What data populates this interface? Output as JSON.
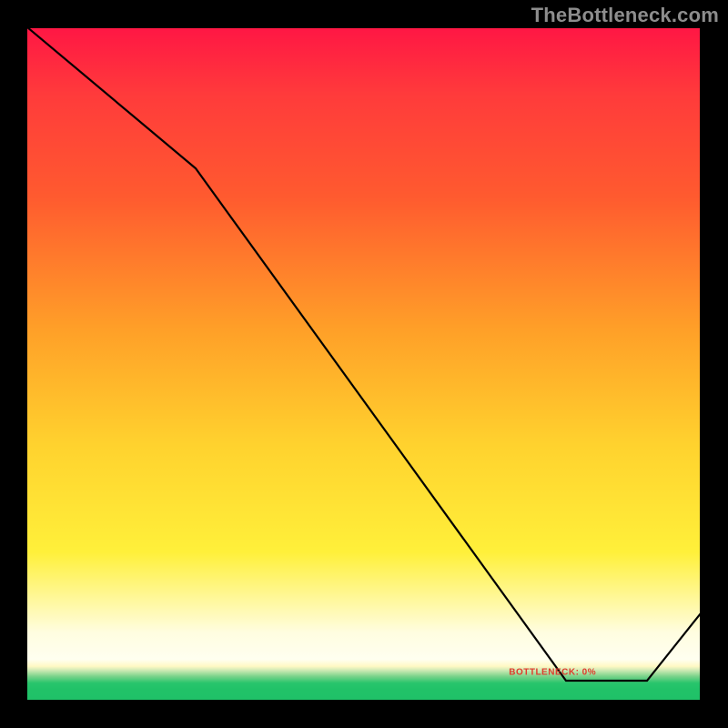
{
  "watermark": "TheBottleneck.com",
  "bottom_label": "BOTTLENECK: 0%",
  "chart_data": {
    "type": "line",
    "title": "",
    "xlabel": "",
    "ylabel": "",
    "xlim": [
      0,
      1
    ],
    "ylim": [
      0,
      1
    ],
    "series": [
      {
        "name": "curve",
        "x": [
          0.0,
          0.25,
          0.8,
          0.92,
          1.0
        ],
        "y": [
          1.0,
          0.79,
          0.03,
          0.03,
          0.13
        ]
      }
    ],
    "annotations": [
      {
        "text": "BOTTLENECK: 0%",
        "x": 0.78,
        "y": 0.042
      }
    ],
    "background_gradient": {
      "direction": "vertical",
      "stops": [
        {
          "pos": 0.0,
          "color": "#ff1744"
        },
        {
          "pos": 0.25,
          "color": "#ff5a2f"
        },
        {
          "pos": 0.62,
          "color": "#ffd22e"
        },
        {
          "pos": 0.9,
          "color": "#fffde0"
        },
        {
          "pos": 0.96,
          "color": "#7bd38b"
        },
        {
          "pos": 1.0,
          "color": "#20c168"
        }
      ]
    }
  }
}
